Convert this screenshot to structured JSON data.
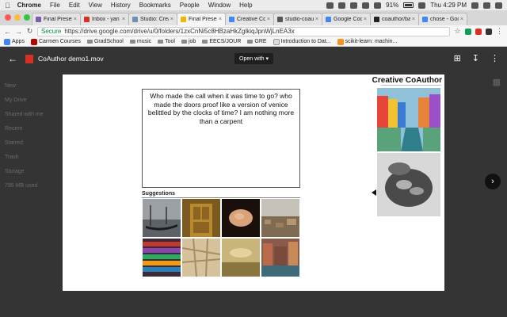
{
  "menubar": {
    "app": "Chrome",
    "items": [
      "File",
      "Edit",
      "View",
      "History",
      "Bookmarks",
      "People",
      "Window",
      "Help"
    ],
    "battery": "91%",
    "clock": "Thu 4:29 PM"
  },
  "tabs": [
    {
      "label": "Final Presen",
      "favicon_color": "#7b5ea7"
    },
    {
      "label": "Inbox - yan",
      "favicon_color": "#d93025"
    },
    {
      "label": "Studio: Crea",
      "favicon_color": "#6f8fb3"
    },
    {
      "label": "Final Presen",
      "favicon_color": "#f4b400",
      "active": true
    },
    {
      "label": "Creative Co",
      "favicon_color": "#4285f4"
    },
    {
      "label": "studio-coau",
      "favicon_color": "#555555"
    },
    {
      "label": "Google Cod",
      "favicon_color": "#4285f4"
    },
    {
      "label": "coauthor/ba",
      "favicon_color": "#222222"
    },
    {
      "label": "chose - Goo",
      "favicon_color": "#4285f4"
    }
  ],
  "address": {
    "secure_label": "Secure",
    "url": "https://drive.google.com/drive/u/0/folders/1zxCnNi5c8HBzaHkZglkiqJpnWjLnEA3x"
  },
  "bookmarks": [
    "Apps",
    "Carmen Courses",
    "GradSchool",
    "music",
    "Tool",
    "job",
    "EECS/JOUR",
    "GRE",
    "Introduction to Dat...",
    "scikit-learn: machin..."
  ],
  "drive": {
    "file_name": "CoAuthor demo1.mov",
    "open_with": "Open with",
    "dimmed_sidebar": [
      "New",
      "My Drive",
      "Shared with me",
      "Recent",
      "Starred",
      "Trash",
      "Storage",
      "795 MB used"
    ]
  },
  "slide": {
    "body_text": "Who made the call when it was time to go? who made the doors proof like a version of venice belittled by the clocks of time? I am nothing more than a carpent",
    "suggestions_label": "Suggestions",
    "brand": "Creative CoAuthor",
    "thumbnails": [
      "gondolas-photo",
      "old-door-photo",
      "sleeping-baby-photo",
      "aerial-city-photo",
      "colorful-books-photo",
      "city-map-photo",
      "golden-landscape-photo",
      "venice-canal-photo"
    ],
    "large_images": [
      "venice-burano-photo",
      "hands-holding-coins-photo"
    ]
  },
  "colors": {
    "traffic_red": "#fc5b57",
    "traffic_yellow": "#fdbc40",
    "traffic_green": "#33c748"
  }
}
